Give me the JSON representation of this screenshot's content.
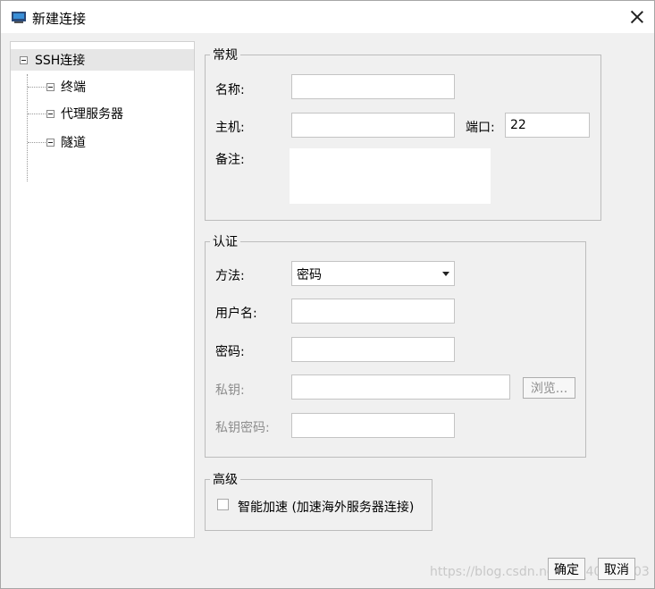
{
  "window": {
    "title": "新建连接",
    "app_icon": "terminal-screen-icon",
    "close_icon": "close-icon"
  },
  "tree": {
    "root": {
      "label": "SSH连接"
    },
    "children": [
      {
        "label": "终端"
      },
      {
        "label": "代理服务器"
      },
      {
        "label": "隧道"
      }
    ]
  },
  "general": {
    "legend": "常规",
    "name_label": "名称:",
    "name_value": "",
    "host_label": "主机:",
    "host_value": "",
    "port_label": "端口:",
    "port_value": "22",
    "note_label": "备注:",
    "note_value": ""
  },
  "auth": {
    "legend": "认证",
    "method_label": "方法:",
    "method_value": "密码",
    "username_label": "用户名:",
    "username_value": "",
    "password_label": "密码:",
    "password_value": "",
    "private_key_label": "私钥:",
    "private_key_value": "",
    "browse_label": "浏览...",
    "key_password_label": "私钥密码:",
    "key_password_value": ""
  },
  "advanced": {
    "legend": "高级",
    "accelerate_label": "智能加速 (加速海外服务器连接)",
    "accelerate_checked": false
  },
  "footer": {
    "ok_label": "确定",
    "cancel_label": "取消"
  },
  "watermark": "https://blog.csdn.net/qq_40235303"
}
